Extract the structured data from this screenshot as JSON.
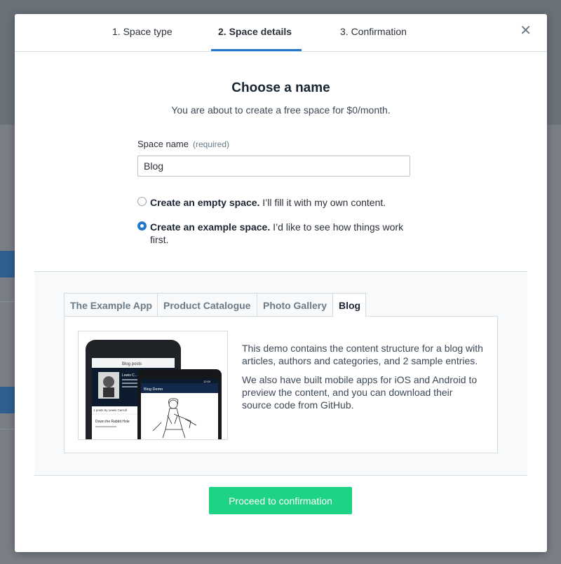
{
  "steps": [
    {
      "label": "1. Space type"
    },
    {
      "label": "2. Space details"
    },
    {
      "label": "3. Confirmation"
    }
  ],
  "close_icon": "close-icon",
  "heading": "Choose a name",
  "subtitle": "You are about to create a free space for $0/month.",
  "space_name": {
    "label": "Space name",
    "required_hint": "(required)",
    "value": "Blog"
  },
  "options": [
    {
      "title": "Create an empty space.",
      "desc": "I’ll fill it with my own content.",
      "checked": false
    },
    {
      "title": "Create an example space.",
      "desc": "I’d like to see how things work first.",
      "checked": true
    }
  ],
  "example_tabs": [
    {
      "label": "The Example App"
    },
    {
      "label": "Product Catalogue"
    },
    {
      "label": "Photo Gallery"
    },
    {
      "label": "Blog"
    }
  ],
  "panel": {
    "para1": "This demo contains the content structure for a blog with articles, authors and categories, and 2 sample entries.",
    "para2": "We also have built mobile apps for iOS and Android to preview the content, and you can download their source code from GitHub."
  },
  "preview": {
    "ios_header": "Blog posts",
    "ios_author": "Lewis C...",
    "ios_posts_label": "1 posts by Lewis Carroll",
    "ios_post_title": "Down the Rabbit Hole",
    "android_header": "Blog Demo",
    "android_time": "12:00"
  },
  "primary_button": "Proceed to confirmation",
  "colors": {
    "accent": "#2478cc",
    "primary_button": "#1ed383"
  }
}
